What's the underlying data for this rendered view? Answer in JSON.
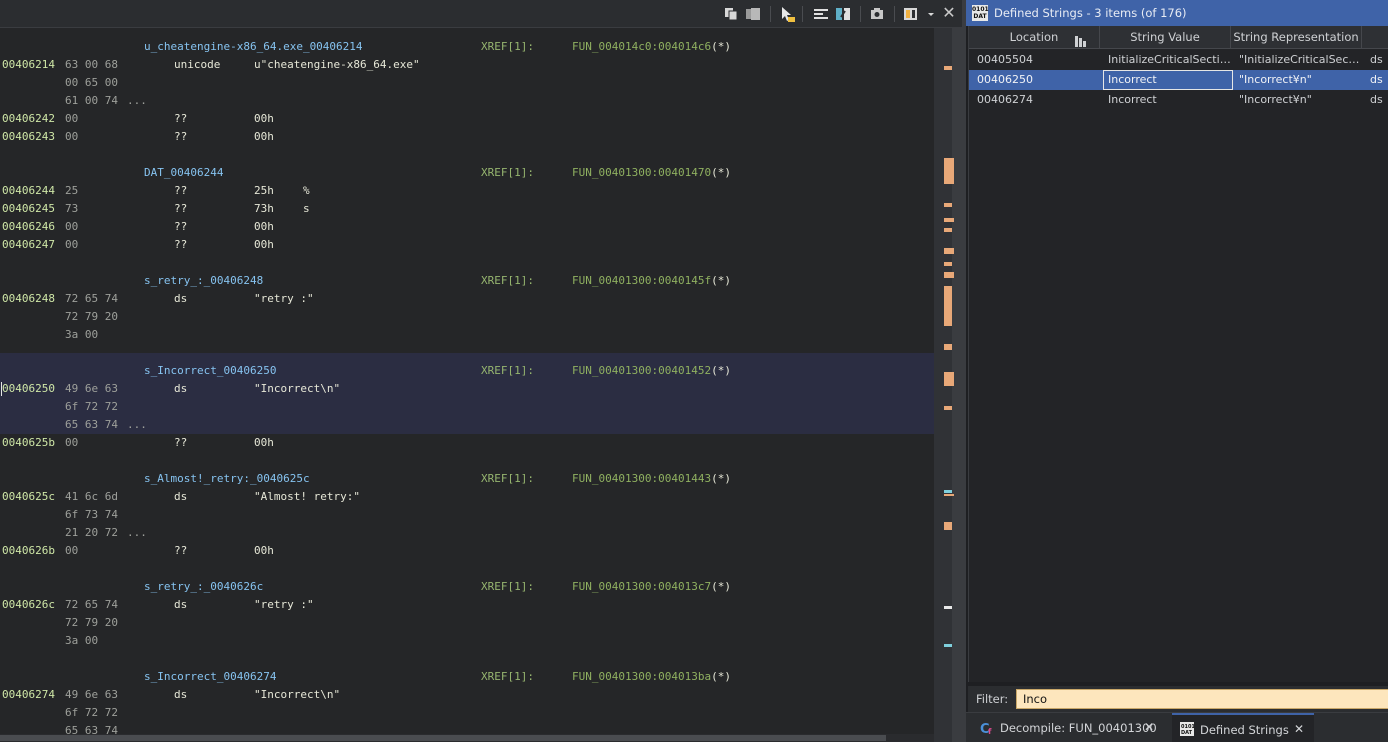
{
  "listing": {
    "toolbar_icons": [
      "copy-icon",
      "paste-icon",
      "cursor-select-icon",
      "field-layout-icon",
      "diff-view-icon",
      "snapshot-icon",
      "code-browser-options-icon",
      "dropdown-arrow-icon",
      "close-icon"
    ],
    "close_glyph": "✕",
    "rows": [
      {
        "kind": "label",
        "label": "u_cheatengine-x86_64.exe_00406214",
        "xref": "XREF[1]:",
        "func": "FUN_004014c0:004014c6",
        "star": "(*)"
      },
      {
        "kind": "code",
        "addr": "00406214",
        "bytes": "63 00 68",
        "mnem": "unicode",
        "oper": "u\"cheatengine-x86_64.exe\"",
        "char": ""
      },
      {
        "kind": "code",
        "addr": "",
        "bytes": "00 65 00",
        "mnem": "",
        "oper": "",
        "char": ""
      },
      {
        "kind": "code",
        "addr": "",
        "bytes": "61 00 74",
        "ell": "...",
        "mnem": "",
        "oper": "",
        "char": ""
      },
      {
        "kind": "code",
        "addr": "00406242",
        "bytes": "00",
        "mnem": "??",
        "oper": "00h",
        "char": ""
      },
      {
        "kind": "code",
        "addr": "00406243",
        "bytes": "00",
        "mnem": "??",
        "oper": "00h",
        "char": ""
      },
      {
        "kind": "blank"
      },
      {
        "kind": "label",
        "label": "DAT_00406244",
        "xref": "XREF[1]:",
        "func": "FUN_00401300:00401470",
        "star": "(*)"
      },
      {
        "kind": "code",
        "addr": "00406244",
        "bytes": "25",
        "mnem": "??",
        "oper": "25h",
        "char": "%"
      },
      {
        "kind": "code",
        "addr": "00406245",
        "bytes": "73",
        "mnem": "??",
        "oper": "73h",
        "char": "s"
      },
      {
        "kind": "code",
        "addr": "00406246",
        "bytes": "00",
        "mnem": "??",
        "oper": "00h",
        "char": ""
      },
      {
        "kind": "code",
        "addr": "00406247",
        "bytes": "00",
        "mnem": "??",
        "oper": "00h",
        "char": ""
      },
      {
        "kind": "blank"
      },
      {
        "kind": "label",
        "label": "s_retry_:_00406248",
        "xref": "XREF[1]:",
        "func": "FUN_00401300:0040145f",
        "star": "(*)"
      },
      {
        "kind": "code",
        "addr": "00406248",
        "bytes": "72 65 74",
        "mnem": "ds",
        "oper": "\"retry :\"",
        "char": ""
      },
      {
        "kind": "code",
        "addr": "",
        "bytes": "72 79 20",
        "mnem": "",
        "oper": "",
        "char": ""
      },
      {
        "kind": "code",
        "addr": "",
        "bytes": "3a 00",
        "mnem": "",
        "oper": "",
        "char": ""
      },
      {
        "kind": "blank"
      },
      {
        "kind": "label",
        "label": "s_Incorrect_00406250",
        "xref": "XREF[1]:",
        "func": "FUN_00401300:00401452",
        "star": "(*)",
        "hl": true
      },
      {
        "kind": "code",
        "addr": "00406250",
        "bytes": "49 6e 63",
        "mnem": "ds",
        "oper": "\"Incorrect\\n\"",
        "char": "",
        "hl": true,
        "cursor": true
      },
      {
        "kind": "code",
        "addr": "",
        "bytes": "6f 72 72",
        "mnem": "",
        "oper": "",
        "char": "",
        "hl": true
      },
      {
        "kind": "code",
        "addr": "",
        "bytes": "65 63 74",
        "ell": "...",
        "mnem": "",
        "oper": "",
        "char": "",
        "hl": true
      },
      {
        "kind": "code",
        "addr": "0040625b",
        "bytes": "00",
        "mnem": "??",
        "oper": "00h",
        "char": ""
      },
      {
        "kind": "blank"
      },
      {
        "kind": "label",
        "label": "s_Almost!_retry:_0040625c",
        "xref": "XREF[1]:",
        "func": "FUN_00401300:00401443",
        "star": "(*)"
      },
      {
        "kind": "code",
        "addr": "0040625c",
        "bytes": "41 6c 6d",
        "mnem": "ds",
        "oper": "\"Almost! retry:\"",
        "char": ""
      },
      {
        "kind": "code",
        "addr": "",
        "bytes": "6f 73 74",
        "mnem": "",
        "oper": "",
        "char": ""
      },
      {
        "kind": "code",
        "addr": "",
        "bytes": "21 20 72",
        "ell": "...",
        "mnem": "",
        "oper": "",
        "char": ""
      },
      {
        "kind": "code",
        "addr": "0040626b",
        "bytes": "00",
        "mnem": "??",
        "oper": "00h",
        "char": ""
      },
      {
        "kind": "blank"
      },
      {
        "kind": "label",
        "label": "s_retry_:_0040626c",
        "xref": "XREF[1]:",
        "func": "FUN_00401300:004013c7",
        "star": "(*)"
      },
      {
        "kind": "code",
        "addr": "0040626c",
        "bytes": "72 65 74",
        "mnem": "ds",
        "oper": "\"retry :\"",
        "char": ""
      },
      {
        "kind": "code",
        "addr": "",
        "bytes": "72 79 20",
        "mnem": "",
        "oper": "",
        "char": ""
      },
      {
        "kind": "code",
        "addr": "",
        "bytes": "3a 00",
        "mnem": "",
        "oper": "",
        "char": ""
      },
      {
        "kind": "blank"
      },
      {
        "kind": "label",
        "label": "s_Incorrect_00406274",
        "xref": "XREF[1]:",
        "func": "FUN_00401300:004013ba",
        "star": "(*)"
      },
      {
        "kind": "code",
        "addr": "00406274",
        "bytes": "49 6e 63",
        "mnem": "ds",
        "oper": "\"Incorrect\\n\"",
        "char": ""
      },
      {
        "kind": "code",
        "addr": "",
        "bytes": "6f 72 72",
        "mnem": "",
        "oper": "",
        "char": ""
      },
      {
        "kind": "code",
        "addr": "",
        "bytes": "65 63 74",
        "mnem": "",
        "oper": "",
        "char": ""
      }
    ]
  },
  "strings_panel": {
    "title": "Defined Strings - 3 items (of 176)",
    "title_icon_text": "0101 DAT",
    "columns": [
      "Location",
      "String Value",
      "String Representation",
      ""
    ],
    "sort_icon": "sort-ascending-icon",
    "rows": [
      {
        "location": "00405504",
        "value": "InitializeCriticalSectio...",
        "repr": "\"InitializeCriticalSecti...",
        "type": "ds",
        "selected": false
      },
      {
        "location": "00406250",
        "value": "Incorrect",
        "repr": "\"Incorrect¥n\"",
        "type": "ds",
        "selected": true
      },
      {
        "location": "00406274",
        "value": "Incorrect",
        "repr": "\"Incorrect¥n\"",
        "type": "ds",
        "selected": false
      }
    ],
    "filter_label": "Filter:",
    "filter_value": "Inco"
  },
  "tabs": [
    {
      "label": "Decompile: FUN_00401300",
      "icon": "decompile-icon",
      "close": "✕",
      "active": false
    },
    {
      "label": "Defined Strings",
      "icon": "defined-strings-icon",
      "close": "✕",
      "active": true
    }
  ],
  "colors": {
    "accent": "#3f63a8",
    "address": "#cfe7a7",
    "label": "#86c3f0",
    "xref": "#96b56f",
    "filter_bg": "#fde6bd",
    "overview_marker": "#e8a878",
    "overview_marker_alt": "#7fd0dd"
  }
}
